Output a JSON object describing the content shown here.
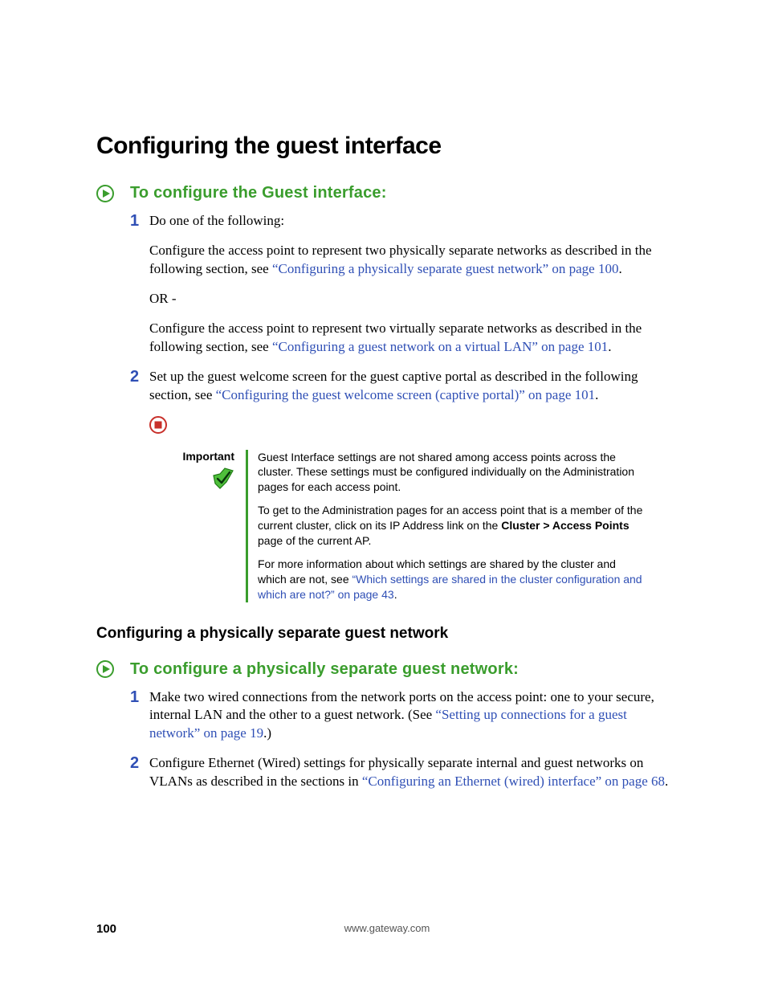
{
  "title": "Configuring the guest interface",
  "proc1": {
    "heading": "To configure the Guest interface:",
    "step1_num": "1",
    "step1_intro": "Do one of the following:",
    "step1_p1a": "Configure the access point to represent two physically separate networks as described in the following section, see ",
    "step1_p1_link": "“Configuring a physically separate guest network” on page 100",
    "step1_p1b": ".",
    "step1_or": "OR -",
    "step1_p2a": "Configure the access point to represent two virtually separate networks as described in the following section, see ",
    "step1_p2_link": "“Configuring a guest network on a virtual LAN” on page 101",
    "step1_p2b": ".",
    "step2_num": "2",
    "step2_a": "Set up the guest welcome screen for the guest captive portal as described in the following section, see ",
    "step2_link": "“Configuring the guest welcome screen (captive portal)” on page 101",
    "step2_b": "."
  },
  "note": {
    "label": "Important",
    "p1": "Guest Interface settings are not shared among access points across the cluster. These settings must be configured individually on the Administration pages for each access point.",
    "p2a": "To get to the Administration pages for an access point that is a member of the current cluster, click on its IP Address link on the ",
    "p2b": "Cluster > Access Points",
    "p2c": " page of the current AP.",
    "p3a": "For more information about which settings are shared by the cluster and which are not, see ",
    "p3_link": "“Which settings are shared in the cluster configuration and which are not?” on page 43",
    "p3b": "."
  },
  "sub_heading": "Configuring a physically separate guest network",
  "proc2": {
    "heading": "To configure a physically separate guest network:",
    "step1_num": "1",
    "step1_a": "Make two wired connections from the network ports on the access point: one to your secure, internal LAN and the other to a guest network. (See ",
    "step1_link": "“Setting up connections for a guest network” on page 19",
    "step1_b": ".)",
    "step2_num": "2",
    "step2_a": "Configure Ethernet (Wired) settings for physically separate internal and guest networks on VLANs as described in the sections in ",
    "step2_link": "“Configuring an Ethernet (wired) interface” on page 68",
    "step2_b": "."
  },
  "footer": {
    "page": "100",
    "url": "www.gateway.com"
  }
}
